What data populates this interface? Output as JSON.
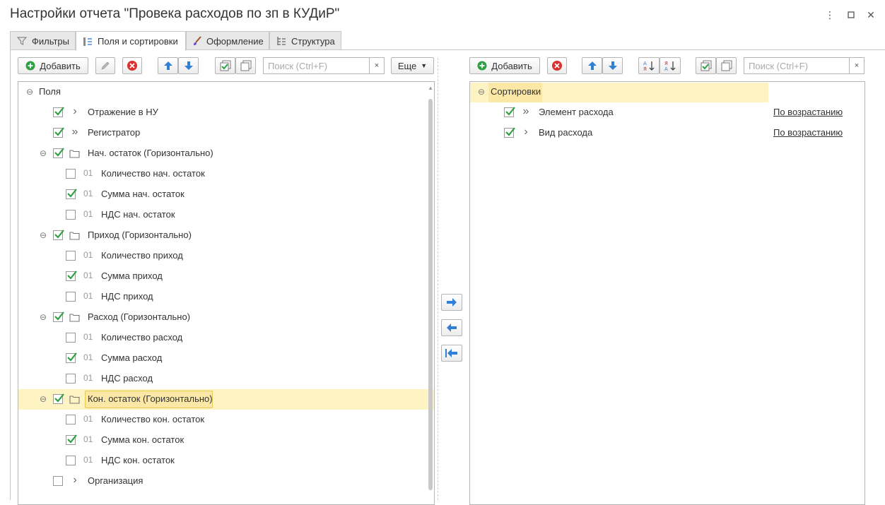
{
  "window": {
    "title": "Настройки отчета \"Провека расходов по зп в КУДиР\"",
    "menu_icon": "more-vert-icon",
    "maximize_icon": "maximize-icon",
    "close_icon": "close-icon"
  },
  "tabs": [
    {
      "label": "Фильтры",
      "icon": "filter-icon"
    },
    {
      "label": "Поля и сортировки",
      "icon": "fields-sort-icon",
      "active": true
    },
    {
      "label": "Оформление",
      "icon": "brush-icon"
    },
    {
      "label": "Структура",
      "icon": "structure-icon"
    }
  ],
  "left_toolbar": {
    "add_label": "Добавить",
    "search_placeholder": "Поиск (Ctrl+F)",
    "clear_label": "×",
    "more_label": "Еще"
  },
  "right_toolbar": {
    "add_label": "Добавить",
    "search_placeholder": "Поиск (Ctrl+F)",
    "clear_label": "×"
  },
  "fields": {
    "root_label": "Поля",
    "items": [
      {
        "label": "Отражение в НУ",
        "checked": true,
        "kind": "expand"
      },
      {
        "label": "Регистратор",
        "checked": true,
        "kind": "double-expand"
      },
      {
        "label": "Нач. остаток (Горизонтально)",
        "checked": true,
        "kind": "group"
      },
      {
        "num": "01",
        "label": "Количество нач. остаток",
        "checked": false,
        "kind": "child"
      },
      {
        "num": "01",
        "label": "Сумма нач. остаток",
        "checked": true,
        "kind": "child"
      },
      {
        "num": "01",
        "label": "НДС нач. остаток",
        "checked": false,
        "kind": "child"
      },
      {
        "label": "Приход (Горизонтально)",
        "checked": true,
        "kind": "group"
      },
      {
        "num": "01",
        "label": "Количество приход",
        "checked": false,
        "kind": "child"
      },
      {
        "num": "01",
        "label": "Сумма приход",
        "checked": true,
        "kind": "child"
      },
      {
        "num": "01",
        "label": "НДС приход",
        "checked": false,
        "kind": "child"
      },
      {
        "label": "Расход (Горизонтально)",
        "checked": true,
        "kind": "group"
      },
      {
        "num": "01",
        "label": "Количество расход",
        "checked": false,
        "kind": "child"
      },
      {
        "num": "01",
        "label": "Сумма расход",
        "checked": true,
        "kind": "child"
      },
      {
        "num": "01",
        "label": "НДС расход",
        "checked": false,
        "kind": "child"
      },
      {
        "label": "Кон. остаток (Горизонтально)",
        "checked": true,
        "kind": "group",
        "selected": true
      },
      {
        "num": "01",
        "label": "Количество кон. остаток",
        "checked": false,
        "kind": "child"
      },
      {
        "num": "01",
        "label": "Сумма кон. остаток",
        "checked": true,
        "kind": "child"
      },
      {
        "num": "01",
        "label": "НДС кон. остаток",
        "checked": false,
        "kind": "child"
      },
      {
        "label": "Организация",
        "checked": false,
        "kind": "expand"
      }
    ]
  },
  "sorts": {
    "root_label": "Сортировки",
    "items": [
      {
        "label": "Элемент расхода",
        "checked": true,
        "kind": "double-expand",
        "direction": "По возрастанию"
      },
      {
        "label": "Вид расхода",
        "checked": true,
        "kind": "expand",
        "direction": "По возрастанию"
      }
    ]
  },
  "colors": {
    "accent_green": "#2ea043",
    "selected_row": "#fdf3c3",
    "selected_box": "#fbe8a6",
    "arrow_blue": "#2f7fd6",
    "delete_red": "#d9302c"
  }
}
